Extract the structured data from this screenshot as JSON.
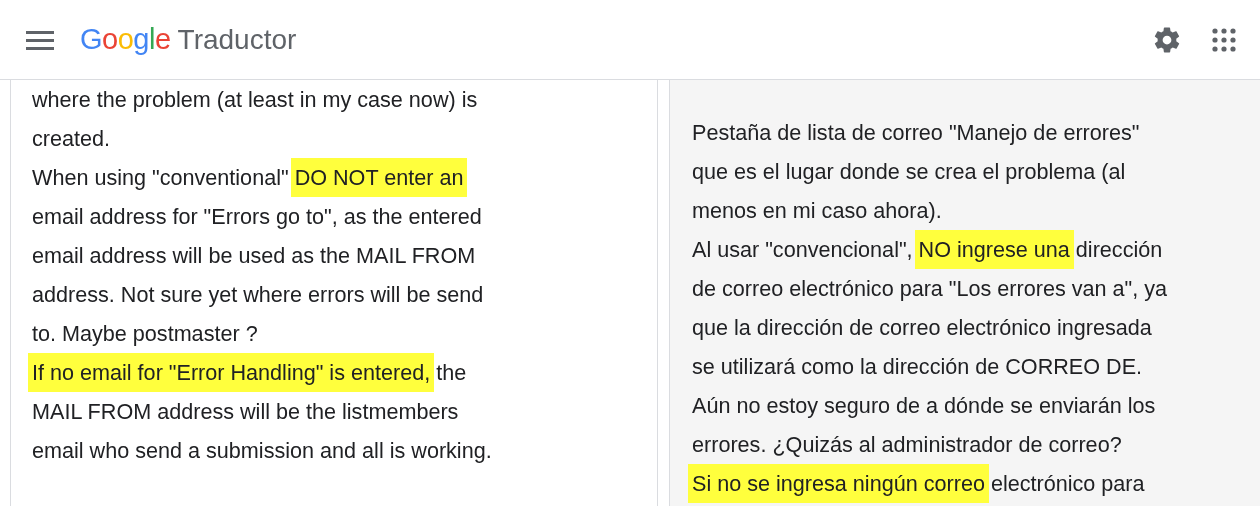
{
  "header": {
    "logo": "Google",
    "product": "Traductor"
  },
  "source_panel": {
    "paragraphs": [
      {
        "segments": [
          {
            "text": "where the problem (at least in my case now) is\ncreated.",
            "highlighted": false
          }
        ]
      },
      {
        "segments": [
          {
            "text": "When using \"conventional\" ",
            "highlighted": false
          },
          {
            "text": "DO NOT enter an",
            "highlighted": true
          },
          {
            "text": "\nemail address for \"Errors go to\", as the entered\nemail address will be used as the MAIL FROM\naddress. Not sure yet where errors will be send\nto. Maybe postmaster ?",
            "highlighted": false
          }
        ]
      },
      {
        "segments": [
          {
            "text": "If no email for \"Error Handling\" is entered,",
            "highlighted": true
          },
          {
            "text": " the\nMAIL FROM address will be the listmembers\nemail who send a submission and all is working.",
            "highlighted": false
          }
        ]
      }
    ]
  },
  "target_panel": {
    "paragraphs": [
      {
        "segments": [
          {
            "text": "Pestaña de lista de correo \"Manejo de errores\"\nque es el lugar donde se crea el problema (al\nmenos en mi caso ahora).",
            "highlighted": false
          }
        ]
      },
      {
        "segments": [
          {
            "text": "Al usar \"convencional\", ",
            "highlighted": false
          },
          {
            "text": "NO ingrese una",
            "highlighted": true
          },
          {
            "text": " dirección\nde correo electrónico para \"Los errores van a\", ya\nque la dirección de correo electrónico ingresada\nse utilizará como la dirección de CORREO DE.\nAún no estoy seguro de a dónde se enviarán los\nerrores. ¿Quizás al administrador de correo?",
            "highlighted": false
          }
        ]
      },
      {
        "segments": [
          {
            "text": "Si no se ingresa ningún correo",
            "highlighted": true
          },
          {
            "text": " electrónico para",
            "highlighted": false
          }
        ]
      }
    ]
  }
}
